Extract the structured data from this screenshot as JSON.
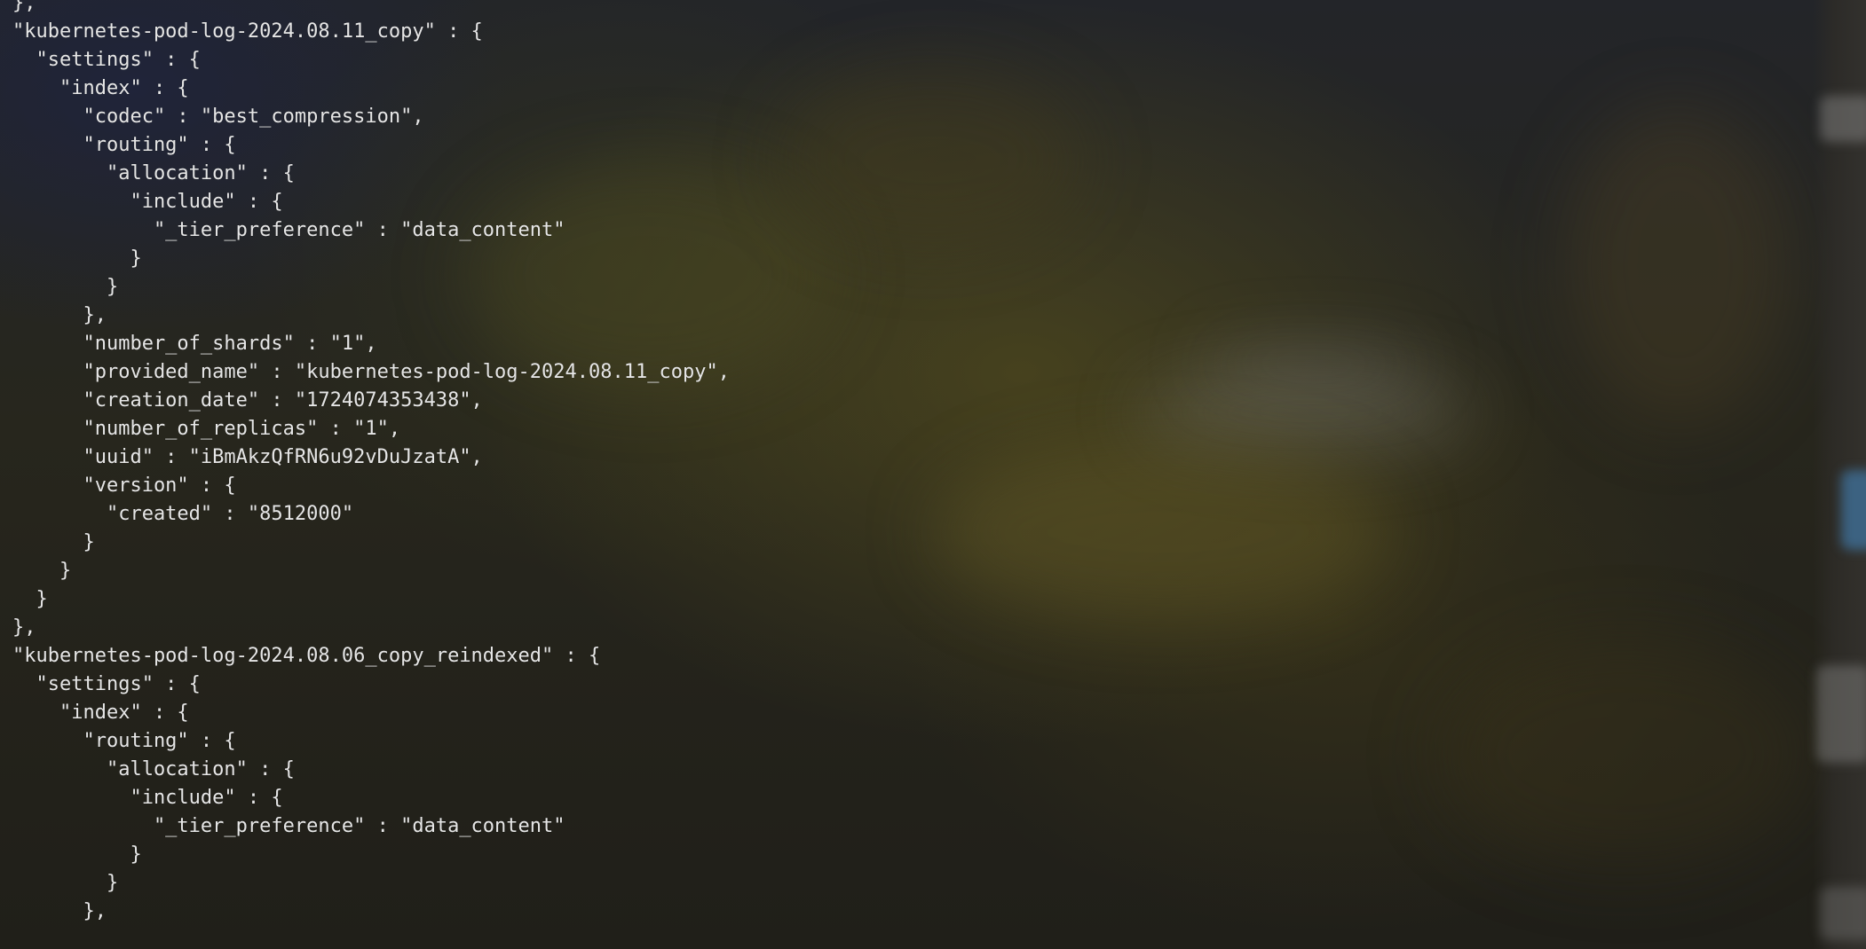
{
  "terminal": {
    "lines": [
      "},",
      "\"kubernetes-pod-log-2024.08.11_copy\" : {",
      "  \"settings\" : {",
      "    \"index\" : {",
      "      \"codec\" : \"best_compression\",",
      "      \"routing\" : {",
      "        \"allocation\" : {",
      "          \"include\" : {",
      "            \"_tier_preference\" : \"data_content\"",
      "          }",
      "        }",
      "      },",
      "      \"number_of_shards\" : \"1\",",
      "      \"provided_name\" : \"kubernetes-pod-log-2024.08.11_copy\",",
      "      \"creation_date\" : \"1724074353438\",",
      "      \"number_of_replicas\" : \"1\",",
      "      \"uuid\" : \"iBmAkzQfRN6u92vDuJzatA\",",
      "      \"version\" : {",
      "        \"created\" : \"8512000\"",
      "      }",
      "    }",
      "  }",
      "},",
      "\"kubernetes-pod-log-2024.08.06_copy_reindexed\" : {",
      "  \"settings\" : {",
      "    \"index\" : {",
      "      \"routing\" : {",
      "        \"allocation\" : {",
      "          \"include\" : {",
      "            \"_tier_preference\" : \"data_content\"",
      "          }",
      "        }",
      "      },"
    ]
  }
}
